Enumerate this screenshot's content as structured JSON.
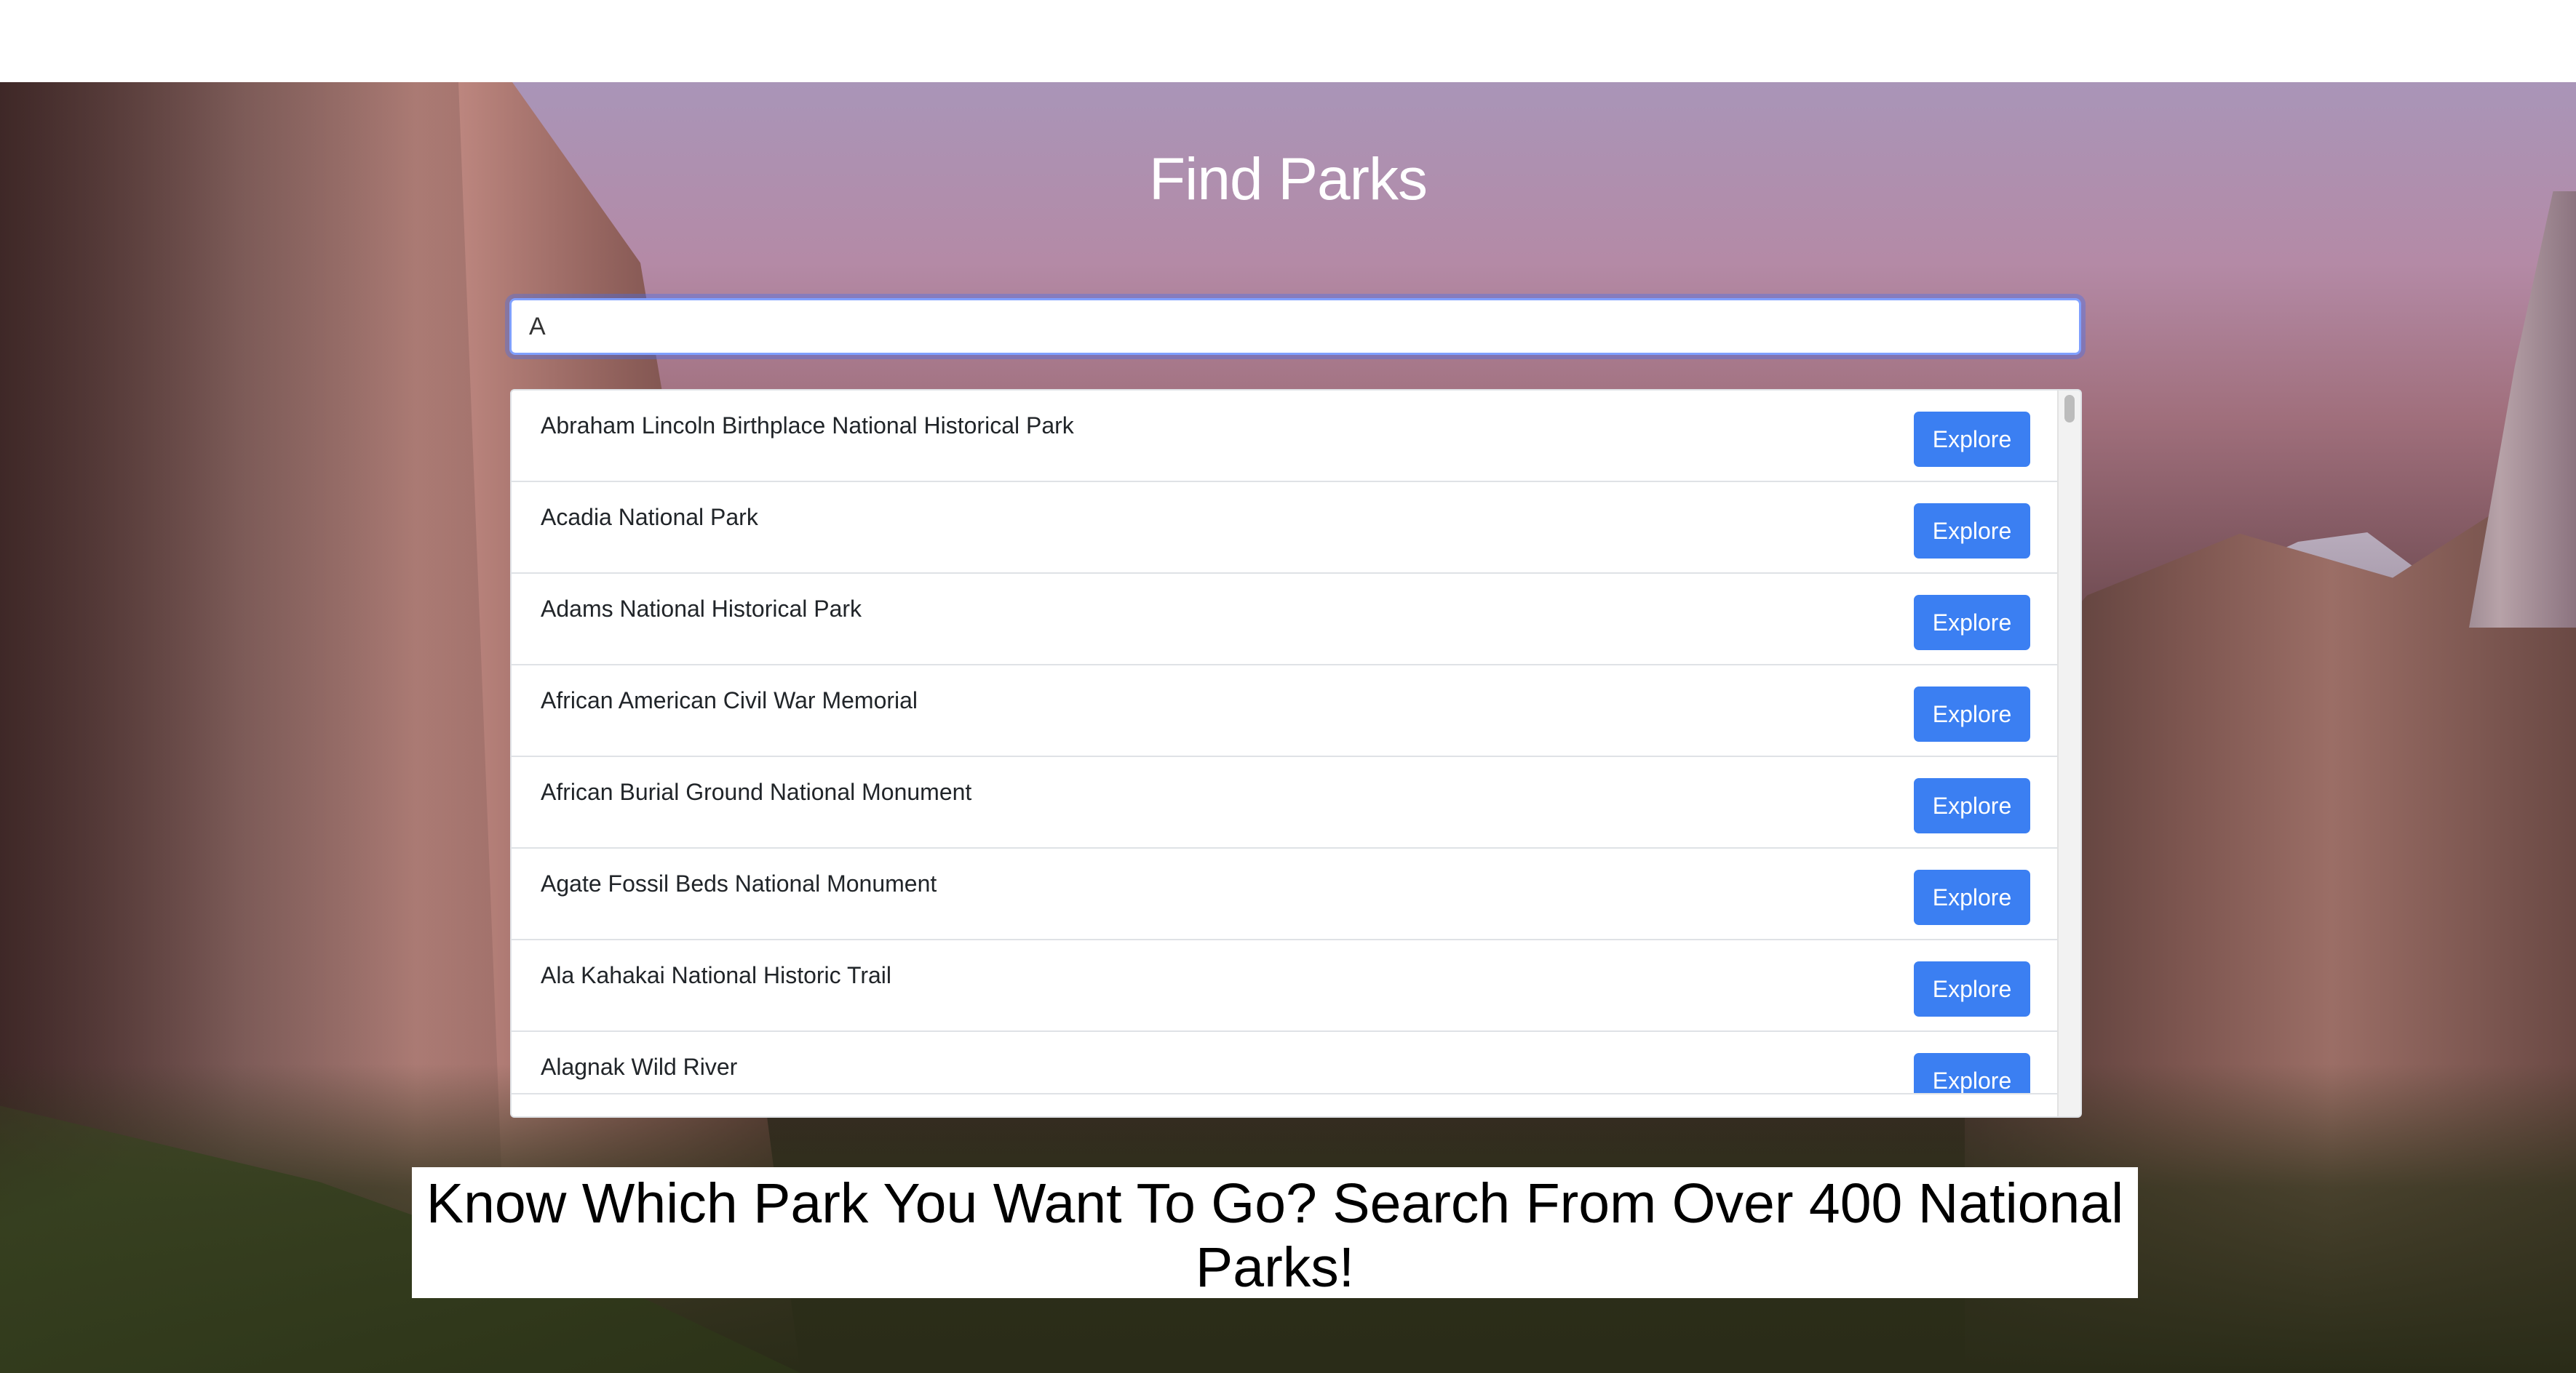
{
  "page": {
    "title": "Find Parks",
    "tagline": "Know Which Park You Want To Go? Search From Over 400 National Parks!"
  },
  "search": {
    "value": "A"
  },
  "results": {
    "button_label": "Explore",
    "items": [
      "Abraham Lincoln Birthplace National Historical Park",
      "Acadia National Park",
      "Adams National Historical Park",
      "African American Civil War Memorial",
      "African Burial Ground National Monument",
      "Agate Fossil Beds National Monument",
      "Ala Kahakai National Historic Trail",
      "Alagnak Wild River"
    ]
  },
  "colors": {
    "accent": "#3b7ff2",
    "focus_ring": "#80a0ff"
  },
  "icons": {
    "background": "mountain-landscape-image"
  }
}
